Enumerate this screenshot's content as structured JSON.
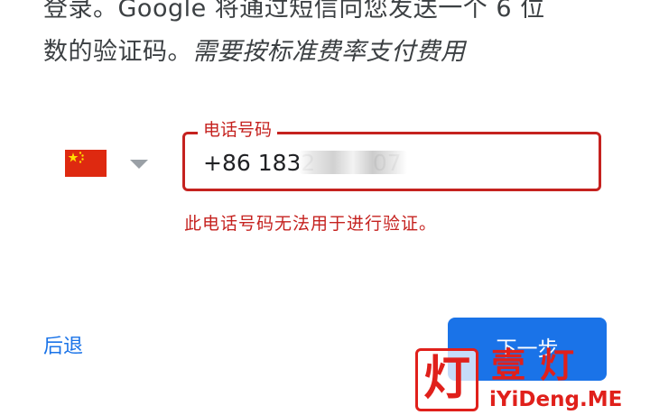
{
  "intro": {
    "line1": "登录。Google 将通过短信向您发送一个 6 位",
    "line2_plain": "数的验证码。",
    "line2_note": "需要按标准费率支付费用"
  },
  "country_selector": {
    "flag_icon": "china-flag-icon",
    "arrow_icon": "caret-down-icon"
  },
  "phone_field": {
    "label": "电话号码",
    "value": "+86 1832        07"
  },
  "error_message": "此电话号码无法用于进行验证。",
  "actions": {
    "back_label": "后退",
    "next_label": "下一步"
  },
  "watermark": {
    "box_char": "灯",
    "title": "壹灯",
    "subtitle": "iYiDeng.ME"
  },
  "colors": {
    "error": "#c5221f",
    "primary": "#1a73e8",
    "text": "#3c4043",
    "watermark": "#e0201b"
  }
}
